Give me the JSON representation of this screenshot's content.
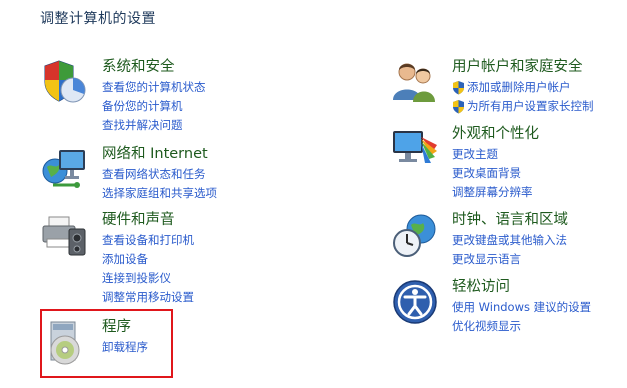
{
  "page_title": "调整计算机的设置",
  "left_column": [
    {
      "key": "system-security",
      "title": "系统和安全",
      "icon": "shield-chart-icon",
      "links": [
        "查看您的计算机状态",
        "备份您的计算机",
        "查找并解决问题"
      ]
    },
    {
      "key": "network-internet",
      "title": "网络和 Internet",
      "icon": "network-globe-icon",
      "links": [
        "查看网络状态和任务",
        "选择家庭组和共享选项"
      ]
    },
    {
      "key": "hardware-sound",
      "title": "硬件和声音",
      "icon": "printer-speaker-icon",
      "links": [
        "查看设备和打印机",
        "添加设备",
        "连接到投影仪",
        "调整常用移动设置"
      ]
    },
    {
      "key": "programs",
      "title": "程序",
      "icon": "programs-disc-icon",
      "links": [
        "卸载程序"
      ]
    }
  ],
  "right_column": [
    {
      "key": "user-accounts",
      "title": "用户帐户和家庭安全",
      "icon": "users-icon",
      "links": [
        "添加或删除用户帐户",
        "为所有用户设置家长控制"
      ]
    },
    {
      "key": "appearance",
      "title": "外观和个性化",
      "icon": "monitor-palette-icon",
      "links": [
        "更改主题",
        "更改桌面背景",
        "调整屏幕分辨率"
      ]
    },
    {
      "key": "clock-region",
      "title": "时钟、语言和区域",
      "icon": "clock-globe-icon",
      "links": [
        "更改键盘或其他输入法",
        "更改显示语言"
      ]
    },
    {
      "key": "ease-of-access",
      "title": "轻松访问",
      "icon": "ease-of-access-icon",
      "links": [
        "使用 Windows 建议的设置",
        "优化视频显示"
      ]
    }
  ],
  "colors": {
    "category_title": "#1e5a1e",
    "link": "#2a5bcc",
    "page_title": "#1e395b",
    "highlight_border": "#e0161b"
  }
}
